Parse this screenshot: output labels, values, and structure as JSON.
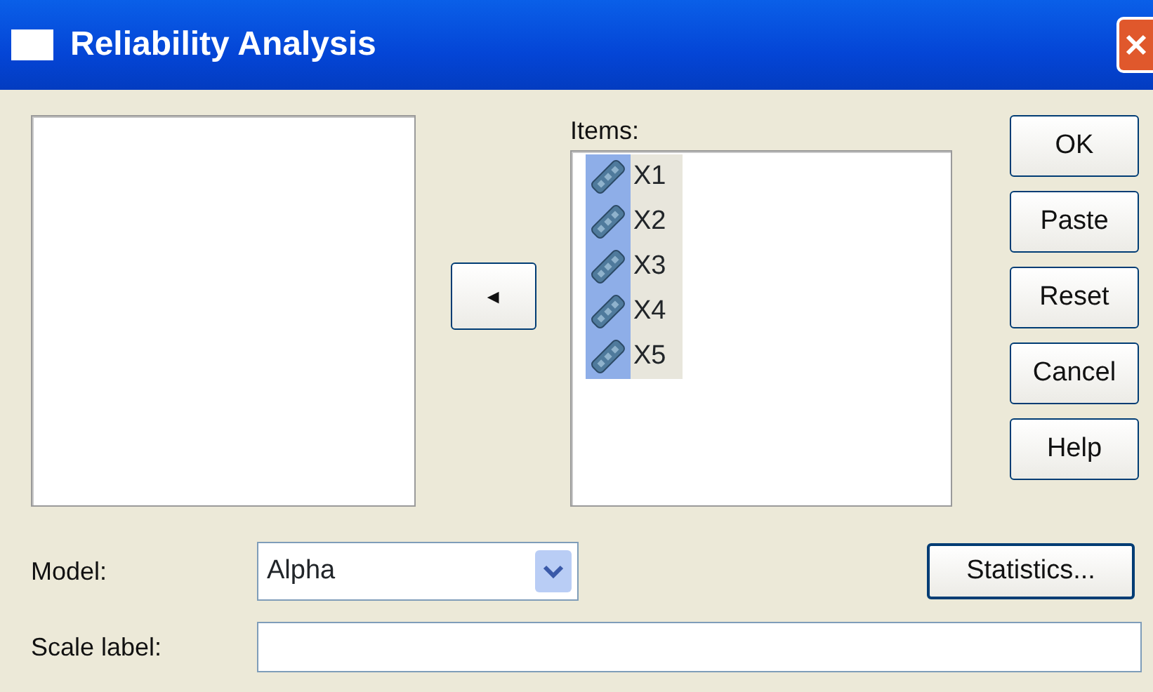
{
  "window": {
    "title": "Reliability Analysis"
  },
  "move_button": {
    "glyph": "◄"
  },
  "items_list": {
    "label": "Items:",
    "items": [
      {
        "name": "X1",
        "selected": true
      },
      {
        "name": "X2",
        "selected": true
      },
      {
        "name": "X3",
        "selected": true
      },
      {
        "name": "X4",
        "selected": true
      },
      {
        "name": "X5",
        "selected": true
      }
    ]
  },
  "buttons": [
    "OK",
    "Paste",
    "Reset",
    "Cancel",
    "Help"
  ],
  "model": {
    "label": "Model:",
    "value": "Alpha"
  },
  "statistics_button": "Statistics...",
  "scale_label": {
    "label": "Scale label:"
  }
}
